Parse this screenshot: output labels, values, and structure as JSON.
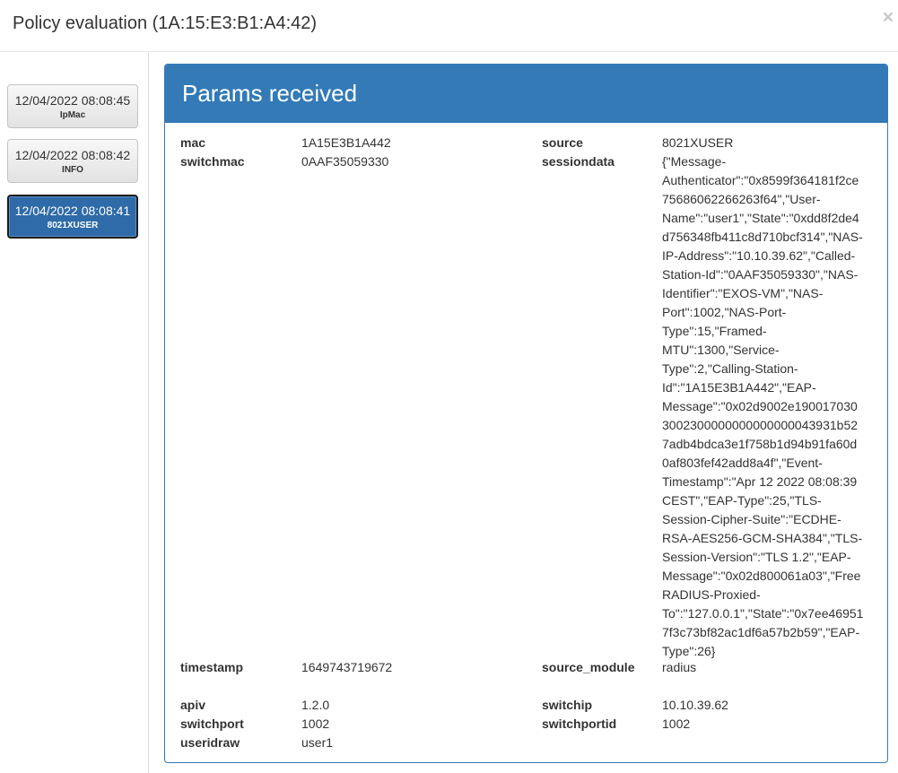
{
  "modal": {
    "title": "Policy evaluation (1A:15:E3:B1:A4:42)",
    "close_symbol": "×"
  },
  "entries": [
    {
      "datetime": "12/04/2022 08:08:45",
      "tag": "IpMac",
      "active": false
    },
    {
      "datetime": "12/04/2022 08:08:42",
      "tag": "INFO",
      "active": false
    },
    {
      "datetime": "12/04/2022 08:08:41",
      "tag": "8021XUSER",
      "active": true
    }
  ],
  "panel": {
    "heading": "Params received",
    "params": {
      "mac": {
        "label": "mac",
        "value": "1A15E3B1A442"
      },
      "switchmac": {
        "label": "switchmac",
        "value": "0AAF35059330"
      },
      "source": {
        "label": "source",
        "value": "8021XUSER"
      },
      "sessiondata": {
        "label": "sessiondata",
        "value": "{\"Message-Authenticator\":\"0x8599f364181f2ce75686062266263f64\",\"User-Name\":\"user1\",\"State\":\"0xdd8f2de4d756348fb411c8d710bcf314\",\"NAS-IP-Address\":\"10.10.39.62\",\"Called-Station-Id\":\"0AAF35059330\",\"NAS-Identifier\":\"EXOS-VM\",\"NAS-Port\":1002,\"NAS-Port-Type\":15,\"Framed-MTU\":1300,\"Service-Type\":2,\"Calling-Station-Id\":\"1A15E3B1A442\",\"EAP-Message\":\"0x02d9002e1900170303002300000000000000043931b527adb4bdca3e1f758b1d94b91fa60d0af803fef42add8a4f\",\"Event-Timestamp\":\"Apr 12 2022 08:08:39 CEST\",\"EAP-Type\":25,\"TLS-Session-Cipher-Suite\":\"ECDHE-RSA-AES256-GCM-SHA384\",\"TLS-Session-Version\":\"TLS 1.2\",\"EAP-Message\":\"0x02d800061a03\",\"FreeRADIUS-Proxied-To\":\"127.0.0.1\",\"State\":\"0x7ee469517f3c73bf82ac1df6a57b2b59\",\"EAP-Type\":26}"
      },
      "timestamp": {
        "label": "timestamp",
        "value": "1649743719672"
      },
      "source_module": {
        "label": "source_module",
        "value": "radius"
      },
      "apiv": {
        "label": "apiv",
        "value": "1.2.0"
      },
      "switchip": {
        "label": "switchip",
        "value": "10.10.39.62"
      },
      "switchport": {
        "label": "switchport",
        "value": "1002"
      },
      "switchportid": {
        "label": "switchportid",
        "value": "1002"
      },
      "useridraw": {
        "label": "useridraw",
        "value": "user1"
      }
    },
    "sessiondata_lines": [
      "{\"Message-",
      "Authenticator\":\"0x8599f364181f2ce",
      "75686062266263f64\",\"User-",
      "Name\":\"user1\",\"State\":\"0xdd8f2de4",
      "d756348fb411c8d710bcf314\",\"NAS-",
      "IP-Address\":\"10.10.39.62\",\"Called-",
      "Station-Id\":\"0AAF35059330\",\"NAS-",
      "Identifier\":\"EXOS-VM\",\"NAS-",
      "Port\":1002,\"NAS-Port-",
      "Type\":15,\"Framed-",
      "MTU\":1300,\"Service-",
      "Type\":2,\"Calling-Station-",
      "Id\":\"1A15E3B1A442\",\"EAP-",
      "Message\":\"0x02d9002e190017030",
      "3002300000000000000043931b52",
      "7adb4bdca3e1f758b1d94b91fa60d",
      "0af803fef42add8a4f\",\"Event-",
      "Timestamp\":\"Apr 12 2022 08:08:39",
      "CEST\",\"EAP-Type\":25,\"TLS-",
      "Session-Cipher-Suite\":\"ECDHE-",
      "RSA-AES256-GCM-SHA384\",\"TLS-",
      "Session-Version\":\"TLS 1.2\",\"EAP-",
      "Message\":\"0x02d800061a03\",\"Free",
      "RADIUS-Proxied-",
      "To\":\"127.0.0.1\",\"State\":\"0x7ee46951",
      "7f3c73bf82ac1df6a57b2b59\",\"EAP-",
      "Type\":26}"
    ]
  }
}
